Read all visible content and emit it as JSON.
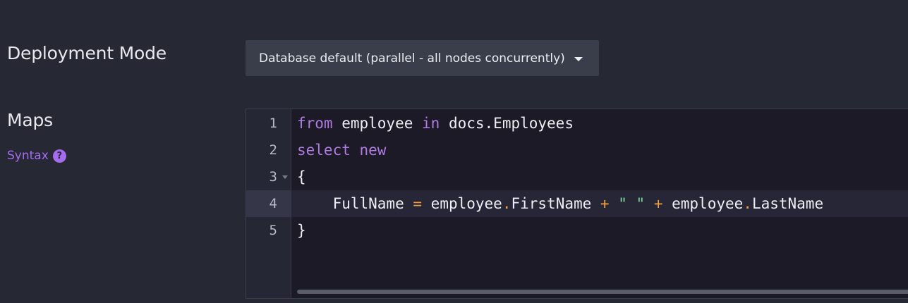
{
  "deployment": {
    "label": "Deployment Mode",
    "selected": "Database default (parallel - all nodes concurrently)"
  },
  "maps": {
    "label": "Maps",
    "syntax_link": "Syntax",
    "help_glyph": "?"
  },
  "editor": {
    "active_line": 4,
    "lines": [
      {
        "number": "1",
        "tokens": [
          {
            "t": "from",
            "c": "kw"
          },
          {
            "t": " employee ",
            "c": "plain"
          },
          {
            "t": "in",
            "c": "kw"
          },
          {
            "t": " docs.Employees",
            "c": "plain"
          }
        ]
      },
      {
        "number": "2",
        "tokens": [
          {
            "t": "select new",
            "c": "kw"
          }
        ]
      },
      {
        "number": "3",
        "tokens": [
          {
            "t": "{",
            "c": "plain"
          }
        ]
      },
      {
        "number": "4",
        "tokens": [
          {
            "t": "    FullName ",
            "c": "plain"
          },
          {
            "t": "=",
            "c": "op"
          },
          {
            "t": " employee",
            "c": "plain"
          },
          {
            "t": ".",
            "c": "op"
          },
          {
            "t": "FirstName ",
            "c": "plain"
          },
          {
            "t": "+",
            "c": "op"
          },
          {
            "t": " ",
            "c": "plain"
          },
          {
            "t": "\" \"",
            "c": "str"
          },
          {
            "t": " ",
            "c": "plain"
          },
          {
            "t": "+",
            "c": "op"
          },
          {
            "t": " employee",
            "c": "plain"
          },
          {
            "t": ".",
            "c": "op"
          },
          {
            "t": "LastName",
            "c": "plain"
          }
        ]
      },
      {
        "number": "5",
        "tokens": [
          {
            "t": "}",
            "c": "plain"
          }
        ]
      }
    ]
  },
  "colors": {
    "background": "#262833",
    "accent": "#a56cf0",
    "keyword": "#b07ce0",
    "operator": "#f0a040",
    "string": "#7ed89b"
  }
}
